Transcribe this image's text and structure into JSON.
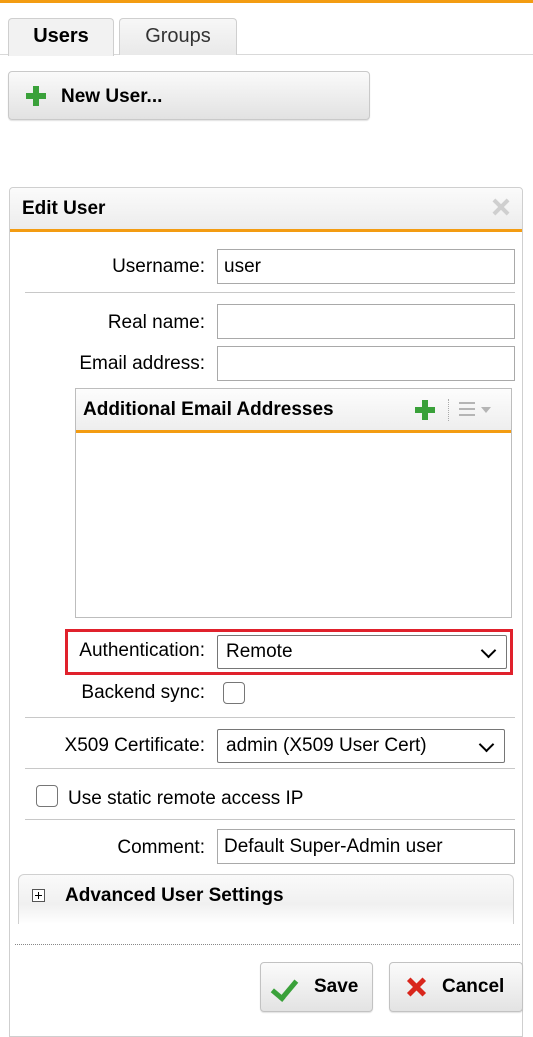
{
  "tabs": [
    "Users",
    "Groups"
  ],
  "toolbar": {
    "new_user_label": "New User..."
  },
  "dialog": {
    "title": "Edit User",
    "username": {
      "label": "Username:",
      "value": "user"
    },
    "real_name": {
      "label": "Real name:",
      "value": ""
    },
    "email": {
      "label": "Email address:",
      "value": ""
    },
    "additional_emails": {
      "title": "Additional Email Addresses"
    },
    "authentication": {
      "label": "Authentication:",
      "value": "Remote"
    },
    "backend_sync": {
      "label": "Backend sync:",
      "checked": false
    },
    "x509": {
      "label": "X509 Certificate:",
      "value": "admin (X509 User Cert)"
    },
    "static_ip": {
      "label": "Use static remote access IP",
      "checked": false
    },
    "comment": {
      "label": "Comment:",
      "value": "Default Super-Admin user"
    },
    "advanced": {
      "label": "Advanced User Settings"
    },
    "save_label": "Save",
    "cancel_label": "Cancel"
  },
  "colors": {
    "accent": "#f39c12",
    "highlight": "#e0212c",
    "green": "#3aa13a",
    "red": "#d9261c"
  }
}
